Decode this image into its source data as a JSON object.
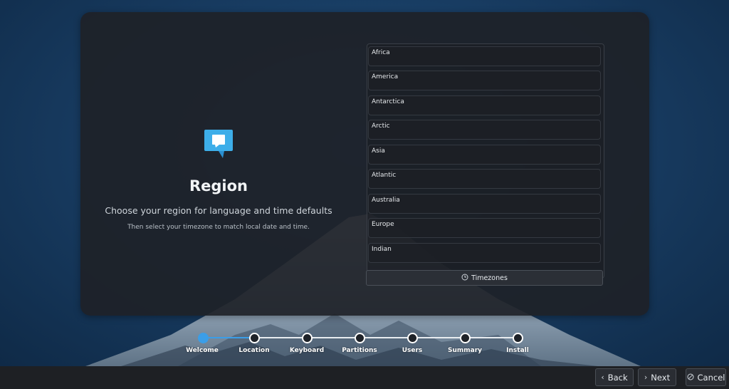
{
  "page": {
    "title": "Region",
    "subtitle": "Choose your region for language and time defaults",
    "hint": "Then select your timezone to match local date and time."
  },
  "regions": [
    {
      "label": "Africa"
    },
    {
      "label": "America"
    },
    {
      "label": "Antarctica"
    },
    {
      "label": "Arctic"
    },
    {
      "label": "Asia"
    },
    {
      "label": "Atlantic"
    },
    {
      "label": "Australia"
    },
    {
      "label": "Europe"
    },
    {
      "label": "Indian"
    }
  ],
  "timezones_button": {
    "label": "Timezones",
    "icon": "clock-icon"
  },
  "steps": [
    {
      "label": "Welcome",
      "state": "active"
    },
    {
      "label": "Location",
      "state": "current"
    },
    {
      "label": "Keyboard",
      "state": "pending"
    },
    {
      "label": "Partitions",
      "state": "pending"
    },
    {
      "label": "Users",
      "state": "pending"
    },
    {
      "label": "Summary",
      "state": "pending"
    },
    {
      "label": "Install",
      "state": "pending"
    }
  ],
  "nav": {
    "back_label": "Back",
    "next_label": "Next",
    "cancel_label": "Cancel"
  },
  "colors": {
    "accent": "#3b9ee8",
    "card": "#1e2128",
    "bottom_bar": "#1e2024"
  }
}
